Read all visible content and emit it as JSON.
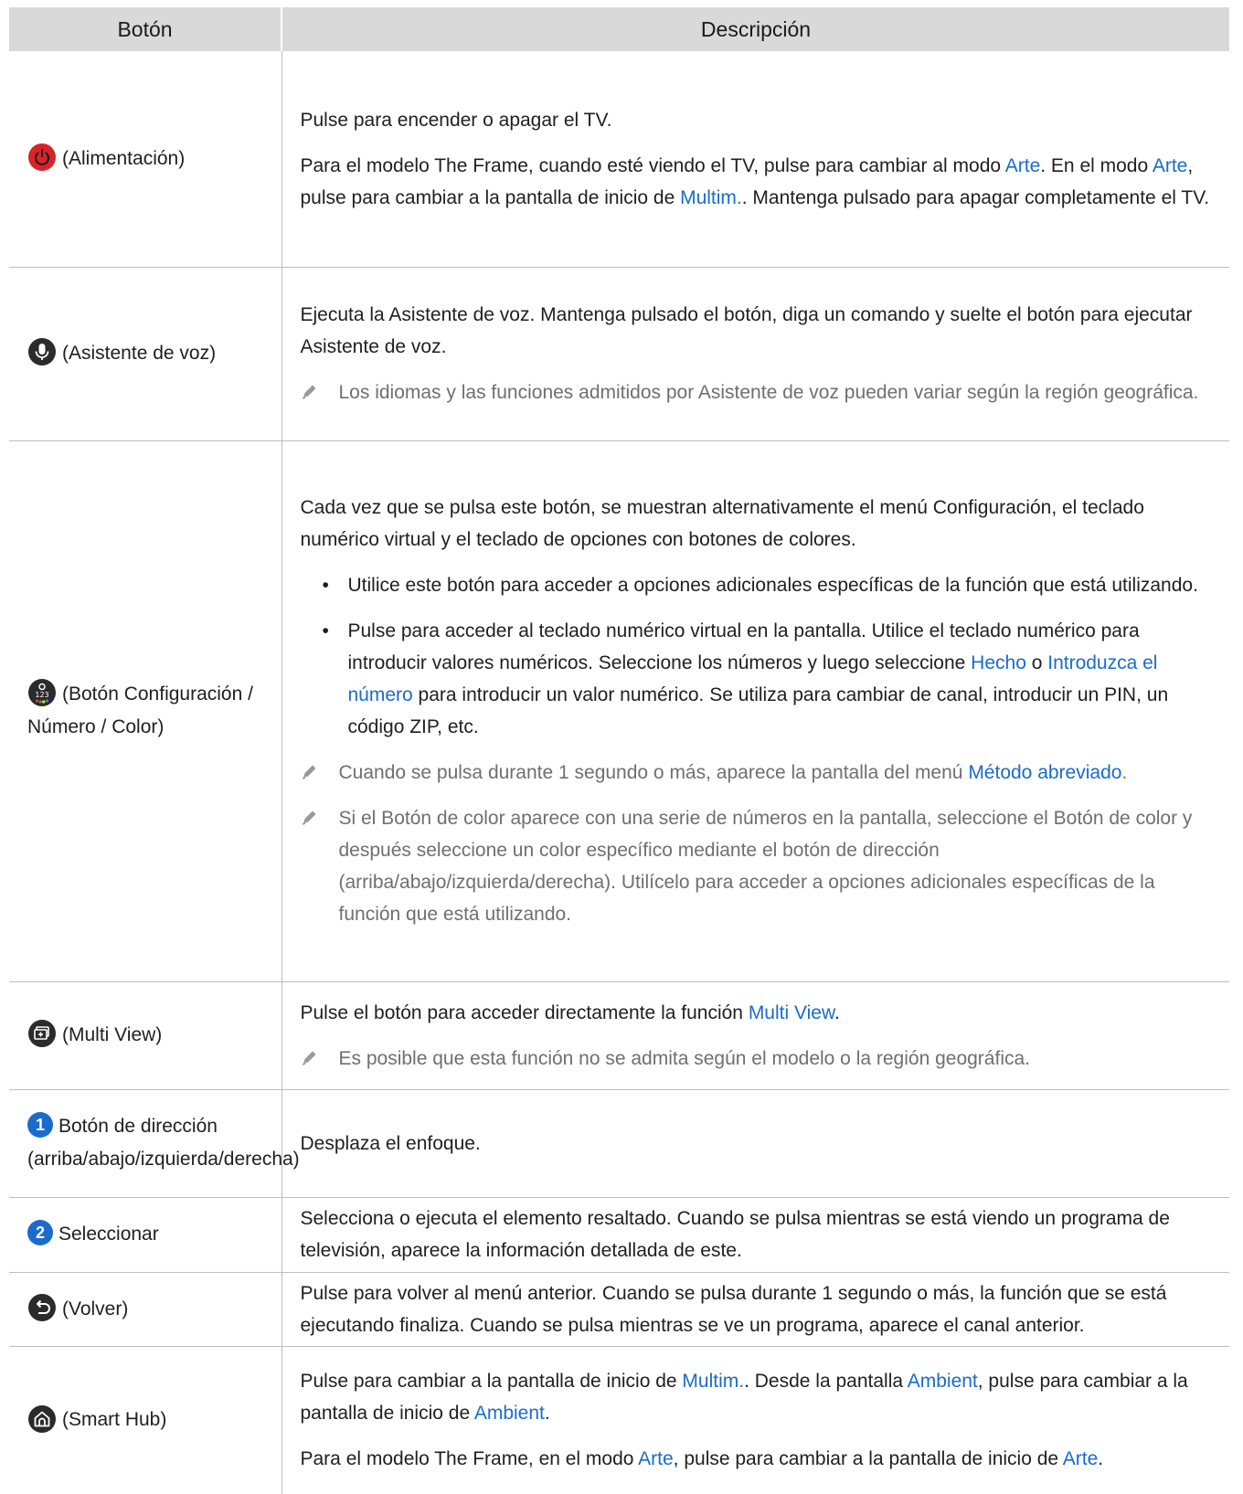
{
  "header": {
    "col1": "Botón",
    "col2": "Descripción"
  },
  "rows": {
    "power": {
      "label": "(Alimentación)",
      "icon": "power-icon",
      "p1": "Pulse para encender o apagar el TV.",
      "p2a": "Para el modelo The Frame, cuando esté viendo el TV, pulse para cambiar al modo ",
      "p2b": "Arte",
      "p2c": ". En el modo ",
      "p2d": "Arte",
      "p2e": ", pulse para cambiar a la pantalla de inicio de ",
      "p2f": "Multim.",
      "p2g": ". Mantenga pulsado para apagar completamente el TV."
    },
    "voice": {
      "label": "(Asistente de voz)",
      "icon": "microphone-icon",
      "p1": "Ejecuta la Asistente de voz. Mantenga pulsado el botón, diga un comando y suelte el botón para ejecutar Asistente de voz.",
      "note": "Los idiomas y las funciones admitidos por Asistente de voz pueden variar según la región geográfica."
    },
    "settings": {
      "label": "(Botón Configuración / Número / Color)",
      "icon": "settings-number-color-icon",
      "p1": "Cada vez que se pulsa este botón, se muestran alternativamente el menú Configuración, el teclado numérico virtual y el teclado de opciones con botones de colores.",
      "b1": "Utilice este botón para acceder a opciones adicionales específicas de la función que está utilizando.",
      "b2a": "Pulse para acceder al teclado numérico virtual en la pantalla. Utilice el teclado numérico para introducir valores numéricos. Seleccione los números y luego seleccione ",
      "b2b": "Hecho",
      "b2c": " o ",
      "b2d": "Introduzca el número",
      "b2e": " para introducir un valor numérico. Se utiliza para cambiar de canal, introducir un PIN, un código ZIP, etc.",
      "n1a": "Cuando se pulsa durante 1 segundo o más, aparece la pantalla del menú ",
      "n1b": "Método abreviado",
      "n1c": ".",
      "n2": "Si el Botón de color aparece con una serie de números en la pantalla, seleccione el Botón de color y después seleccione un color específico mediante el botón de dirección (arriba/abajo/izquierda/derecha). Utilícelo para acceder a opciones adicionales específicas de la función que está utilizando."
    },
    "multiview": {
      "label": "(Multi View)",
      "icon": "multi-view-icon",
      "p1a": "Pulse el botón para acceder directamente la función ",
      "p1b": "Multi View",
      "p1c": ".",
      "note": "Es posible que esta función no se admita según el modelo o la región geográfica."
    },
    "direction": {
      "num": "1",
      "label": "Botón de dirección (arriba/abajo/izquierda/derecha)",
      "p1": "Desplaza el enfoque."
    },
    "select": {
      "num": "2",
      "label": "Seleccionar",
      "p1": "Selecciona o ejecuta el elemento resaltado. Cuando se pulsa mientras se está viendo un programa de televisión, aparece la información detallada de este."
    },
    "back": {
      "label": "(Volver)",
      "icon": "back-icon",
      "p1": "Pulse para volver al menú anterior. Cuando se pulsa durante 1 segundo o más, la función que se está ejecutando finaliza. Cuando se pulsa mientras se ve un programa, aparece el canal anterior."
    },
    "smarthub": {
      "label": "(Smart Hub)",
      "icon": "home-icon",
      "p1a": "Pulse para cambiar a la pantalla de inicio de ",
      "p1b": "Multim.",
      "p1c": ". Desde la pantalla ",
      "p1d": "Ambient",
      "p1e": ", pulse para cambiar a la pantalla de inicio de ",
      "p1f": "Ambient",
      "p1g": ".",
      "p2a": "Para el modelo The Frame, en el modo ",
      "p2b": "Arte",
      "p2c": ", pulse para cambiar a la pantalla de inicio de ",
      "p2d": "Arte",
      "p2e": "."
    }
  },
  "colors": {
    "highlight": "#1a6bcc",
    "header_bg": "#d9d9d9",
    "note_text": "#6f6f6f",
    "power_red": "#d8232a"
  }
}
